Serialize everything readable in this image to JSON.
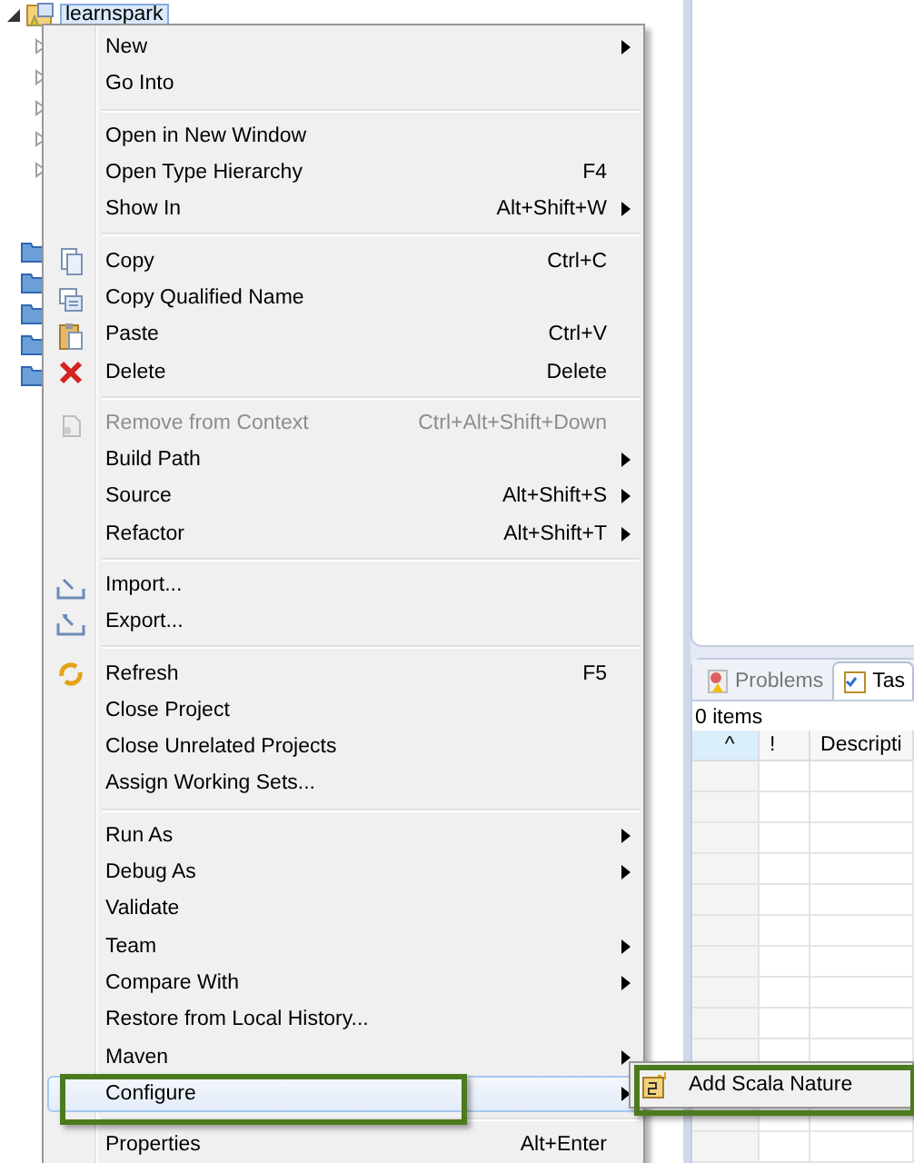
{
  "tree": {
    "root": {
      "label": "learnspark",
      "selected": true,
      "expanded": true
    },
    "children": [
      {
        "kind": "package",
        "expanded": false
      },
      {
        "kind": "package",
        "expanded": false
      },
      {
        "kind": "package",
        "expanded": false
      },
      {
        "kind": "package",
        "expanded": false
      },
      {
        "kind": "package",
        "expanded": false
      },
      {
        "kind": "folder"
      },
      {
        "kind": "folder"
      },
      {
        "kind": "folder"
      },
      {
        "kind": "folder"
      },
      {
        "kind": "folder"
      }
    ]
  },
  "context_menu": {
    "groups": [
      [
        {
          "label": "New",
          "submenu": true,
          "disabled": false,
          "selected": false,
          "outlined": false
        },
        {
          "label": "Go Into",
          "submenu": false,
          "disabled": false,
          "selected": false,
          "outlined": false
        }
      ],
      [
        {
          "label": "Open in New Window",
          "submenu": false,
          "disabled": false,
          "selected": false,
          "outlined": false
        },
        {
          "label": "Open Type Hierarchy",
          "shortcut": "F4",
          "submenu": false,
          "disabled": false,
          "selected": false,
          "outlined": false
        },
        {
          "label": "Show In",
          "shortcut": "Alt+Shift+W",
          "submenu": true,
          "disabled": false,
          "selected": false,
          "outlined": false
        }
      ],
      [
        {
          "label": "Copy",
          "shortcut": "Ctrl+C",
          "submenu": false,
          "disabled": false,
          "selected": false,
          "outlined": false
        },
        {
          "label": "Copy Qualified Name",
          "submenu": false,
          "disabled": false,
          "selected": false,
          "outlined": false
        },
        {
          "label": "Paste",
          "shortcut": "Ctrl+V",
          "submenu": false,
          "disabled": false,
          "selected": false,
          "outlined": false
        },
        {
          "label": "Delete",
          "shortcut": "Delete",
          "submenu": false,
          "disabled": false,
          "selected": false,
          "outlined": false
        }
      ],
      [
        {
          "label": "Remove from Context",
          "shortcut": "Ctrl+Alt+Shift+Down",
          "submenu": false,
          "disabled": true,
          "selected": false,
          "outlined": false
        },
        {
          "label": "Build Path",
          "submenu": true,
          "disabled": false,
          "selected": false,
          "outlined": false
        },
        {
          "label": "Source",
          "shortcut": "Alt+Shift+S",
          "submenu": true,
          "disabled": false,
          "selected": false,
          "outlined": false
        },
        {
          "label": "Refactor",
          "shortcut": "Alt+Shift+T",
          "submenu": true,
          "disabled": false,
          "selected": false,
          "outlined": false
        }
      ],
      [
        {
          "label": "Import...",
          "submenu": false,
          "disabled": false,
          "selected": false,
          "outlined": false
        },
        {
          "label": "Export...",
          "submenu": false,
          "disabled": false,
          "selected": false,
          "outlined": false
        }
      ],
      [
        {
          "label": "Refresh",
          "shortcut": "F5",
          "submenu": false,
          "disabled": false,
          "selected": false,
          "outlined": false
        },
        {
          "label": "Close Project",
          "submenu": false,
          "disabled": false,
          "selected": false,
          "outlined": false
        },
        {
          "label": "Close Unrelated Projects",
          "submenu": false,
          "disabled": false,
          "selected": false,
          "outlined": false
        },
        {
          "label": "Assign Working Sets...",
          "submenu": false,
          "disabled": false,
          "selected": false,
          "outlined": false
        }
      ],
      [
        {
          "label": "Run As",
          "submenu": true,
          "disabled": false,
          "selected": false,
          "outlined": false
        },
        {
          "label": "Debug As",
          "submenu": true,
          "disabled": false,
          "selected": false,
          "outlined": false
        },
        {
          "label": "Validate",
          "submenu": false,
          "disabled": false,
          "selected": false,
          "outlined": false
        },
        {
          "label": "Team",
          "submenu": true,
          "disabled": false,
          "selected": false,
          "outlined": false
        },
        {
          "label": "Compare With",
          "submenu": true,
          "disabled": false,
          "selected": false,
          "outlined": false
        },
        {
          "label": "Restore from Local History...",
          "submenu": false,
          "disabled": false,
          "selected": false,
          "outlined": false
        },
        {
          "label": "Maven",
          "submenu": true,
          "disabled": false,
          "selected": false,
          "outlined": false
        },
        {
          "label": "Configure",
          "submenu": true,
          "disabled": false,
          "selected": true,
          "outlined": true
        }
      ],
      [
        {
          "label": "Properties",
          "shortcut": "Alt+Enter",
          "submenu": false,
          "disabled": false,
          "selected": false,
          "outlined": false
        }
      ]
    ]
  },
  "submenu": {
    "items": [
      {
        "label": "Add Scala Nature",
        "selected": false,
        "outlined": true
      }
    ]
  },
  "bottom_panel": {
    "tabs": [
      {
        "label": "Problems",
        "selected": false
      },
      {
        "label": "Tas",
        "selected": true
      }
    ],
    "summary": "0 items",
    "table": {
      "columns": [
        "^",
        "!",
        "Descripti"
      ]
    }
  }
}
